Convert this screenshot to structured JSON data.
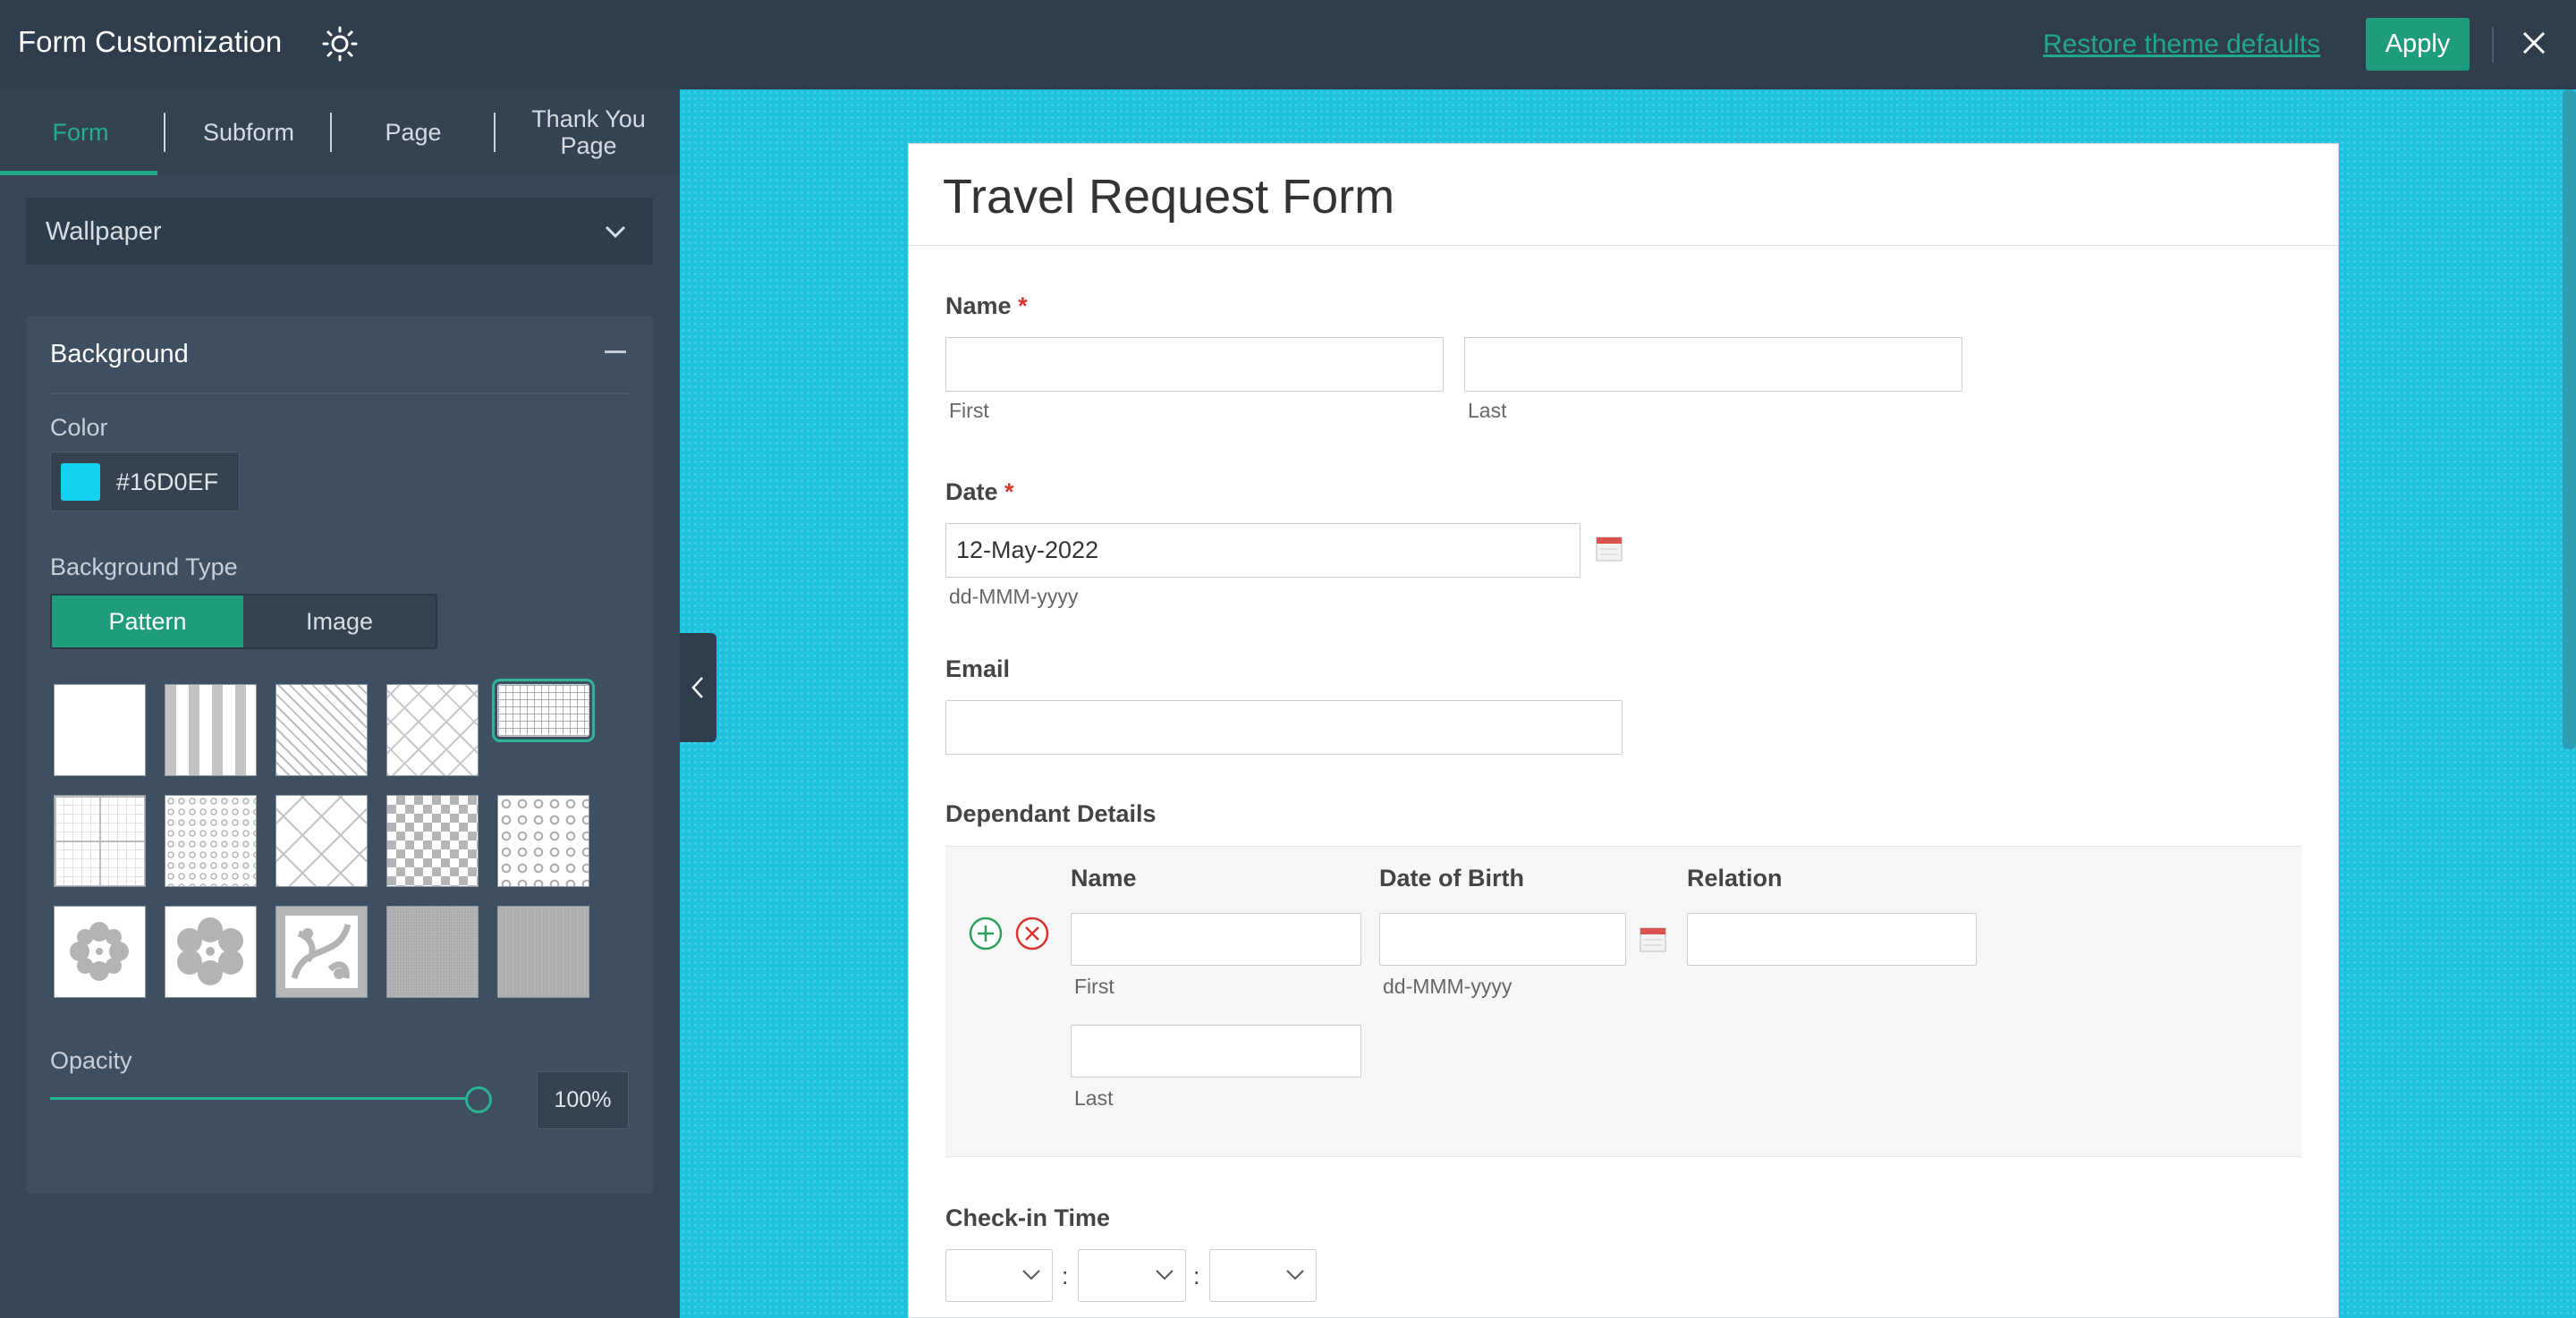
{
  "app": {
    "title": "Form Customization",
    "restore_label": "Restore theme defaults",
    "apply_label": "Apply"
  },
  "tabs": [
    {
      "label": "Form"
    },
    {
      "label": "Subform"
    },
    {
      "label": "Page"
    },
    {
      "label": "Thank You Page"
    }
  ],
  "panel": {
    "section_select": "Wallpaper",
    "card_title": "Background",
    "color_label": "Color",
    "color_value": "#16D0EF",
    "bg_type_label": "Background Type",
    "bg_type_options": [
      "Pattern",
      "Image"
    ],
    "bg_type_selected": "Pattern",
    "opacity_label": "Opacity",
    "opacity_value": "100%",
    "opacity_fraction": 1.0,
    "selected_pattern": "pattern-small-grid"
  },
  "colors": {
    "accent": "#1e9c7c",
    "canvas_bg": "#16D0EF",
    "topbar": "#2f3d4c"
  },
  "form": {
    "title": "Travel Request Form",
    "name_label": "Name",
    "required_mark": "*",
    "first_sub": "First",
    "last_sub": "Last",
    "date_label": "Date",
    "date_value": "12-May-2022",
    "date_format": "dd-MMM-yyyy",
    "email_label": "Email",
    "dependant_label": "Dependant Details",
    "dependant_columns": [
      "Name",
      "Date of Birth",
      "Relation"
    ],
    "dependant_first_sub": "First",
    "dependant_last_sub": "Last",
    "dependant_dob_format": "dd-MMM-yyyy",
    "checkin_label": "Check-in Time",
    "time_sep": ":"
  }
}
